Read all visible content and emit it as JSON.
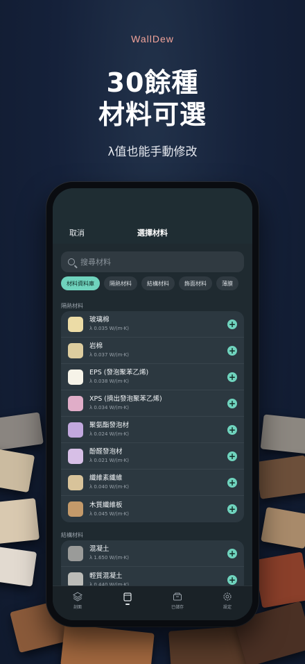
{
  "hero": {
    "brand": "WallDew",
    "title_line1": "30餘種",
    "title_line2": "材料可選",
    "subtitle": "λ值也能手動修改"
  },
  "sheet": {
    "cancel_label": "取消",
    "title": "選擇材料",
    "search_placeholder": "搜尋材料"
  },
  "chips": [
    "材料資料庫",
    "隔熱材料",
    "結構材料",
    "飾面材料",
    "薄膜"
  ],
  "sections": [
    {
      "label": "隔熱材料",
      "items": [
        {
          "name": "玻璃棉",
          "value": "λ 0.035 W/(m·K)",
          "color": "#ecdca6"
        },
        {
          "name": "岩棉",
          "value": "λ 0.037 W/(m·K)",
          "color": "#ddcd9f"
        },
        {
          "name": "EPS (發泡聚苯乙烯)",
          "value": "λ 0.038 W/(m·K)",
          "color": "#f6f3e8"
        },
        {
          "name": "XPS (擠出發泡聚苯乙烯)",
          "value": "λ 0.034 W/(m·K)",
          "color": "#e0adc8"
        },
        {
          "name": "聚氨酯發泡材",
          "value": "λ 0.024 W/(m·K)",
          "color": "#c2a8de"
        },
        {
          "name": "酚醛發泡材",
          "value": "λ 0.021 W/(m·K)",
          "color": "#d7bfe6"
        },
        {
          "name": "纖維素纖維",
          "value": "λ 0.040 W/(m·K)",
          "color": "#d8c39a"
        },
        {
          "name": "木質纖維板",
          "value": "λ 0.045 W/(m·K)",
          "color": "#c49a6a"
        }
      ]
    },
    {
      "label": "結構材料",
      "items": [
        {
          "name": "混凝土",
          "value": "λ 1.650 W/(m·K)",
          "color": "#9a9b99"
        },
        {
          "name": "輕質混凝土",
          "value": "λ 0.440 W/(m·K)",
          "color": "#bcbcb8"
        }
      ]
    }
  ],
  "tabbar": [
    {
      "label": "剖面",
      "icon": "layers-icon"
    },
    {
      "label": "",
      "icon": "wall-icon"
    },
    {
      "label": "已儲存",
      "icon": "archive-icon"
    },
    {
      "label": "設定",
      "icon": "gear-icon"
    }
  ],
  "colors": {
    "accent": "#6fd3bd",
    "brand": "#f2a49a"
  }
}
